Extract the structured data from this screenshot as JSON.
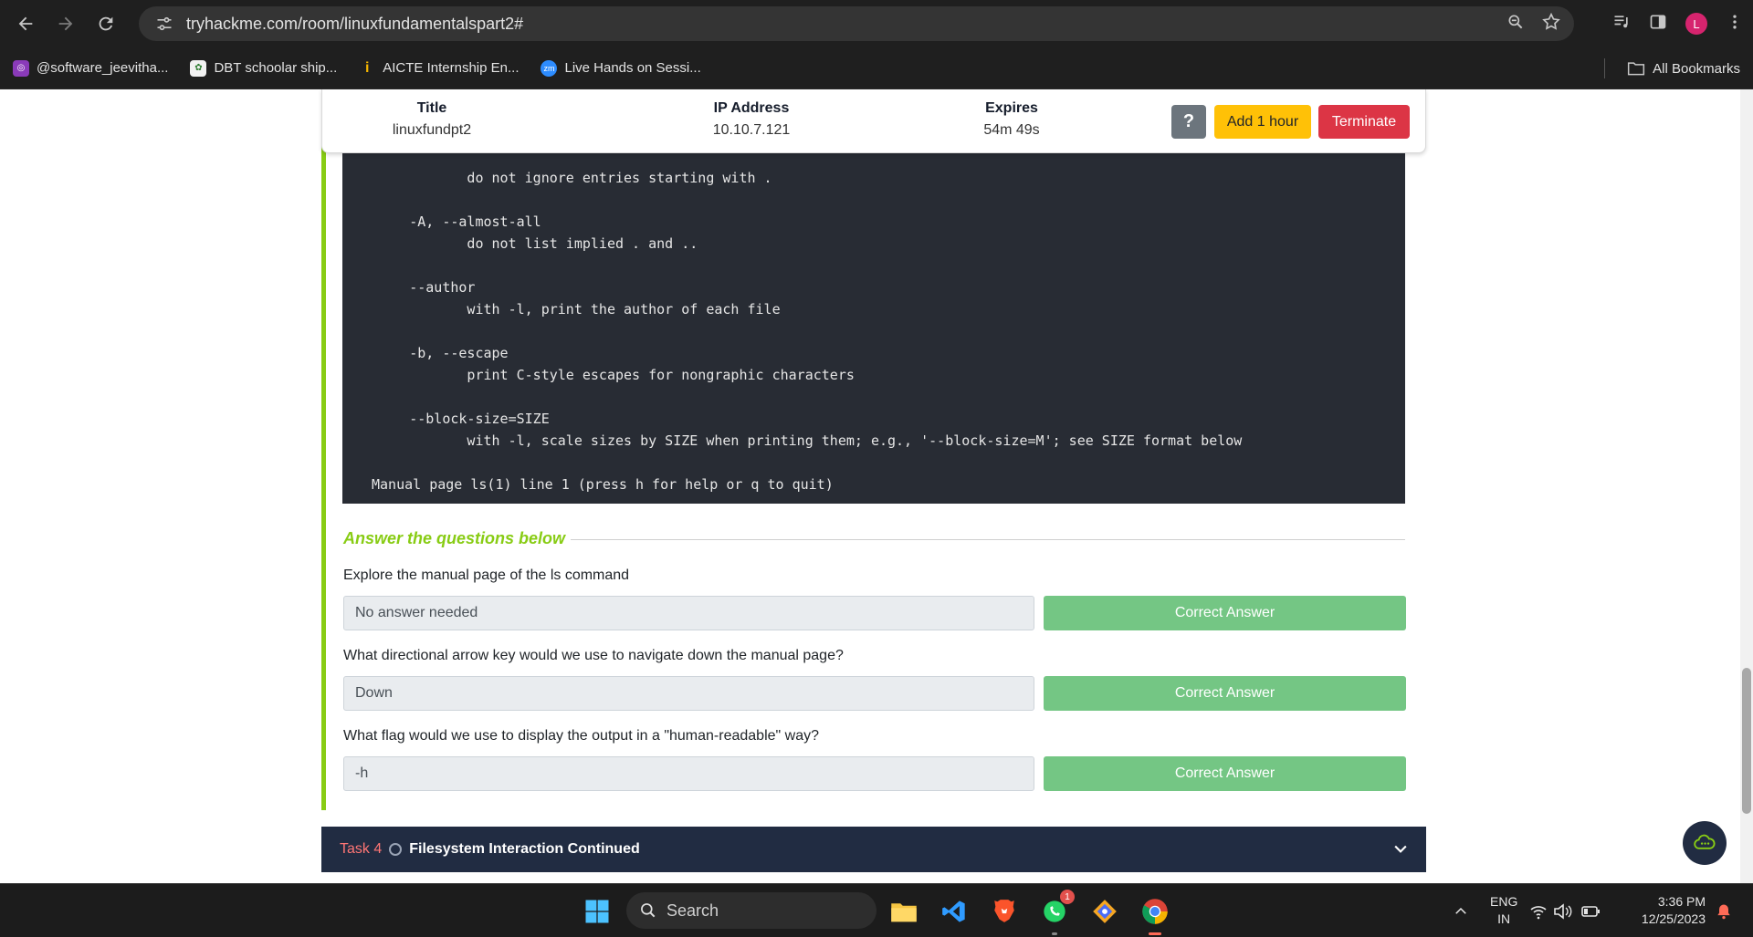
{
  "browser": {
    "url": "tryhackme.com/room/linuxfundamentalspart2#",
    "profile_initial": "L",
    "bookmarks": [
      {
        "label": "@software_jeevitha...",
        "icon": "instagram-icon",
        "color": "#8a3ab9"
      },
      {
        "label": "DBT schoolar ship...",
        "icon": "emblem-icon",
        "color": "#f2f2f2"
      },
      {
        "label": "AICTE Internship En...",
        "icon": "aicte-icon",
        "color": "#f4b400"
      },
      {
        "label": "Live Hands on Sessi...",
        "icon": "zoom-icon",
        "color": "#2d8cff"
      }
    ],
    "all_bookmarks_label": "All Bookmarks"
  },
  "vm": {
    "title_header": "Title",
    "title_value": "linuxfundpt2",
    "ip_header": "IP Address",
    "ip_value": "10.10.7.121",
    "expires_header": "Expires",
    "expires_value": "54m 49s",
    "help_label": "?",
    "add_hour_label": "Add 1 hour",
    "terminate_label": "Terminate"
  },
  "terminal": {
    "lines": [
      "              do not ignore entries starting with .",
      "       -A, --almost-all",
      "              do not list implied . and ..",
      "       --author",
      "              with -l, print the author of each file",
      "       -b, --escape",
      "              print C-style escapes for nongraphic characters",
      "       --block-size=SIZE",
      "              with -l, scale sizes by SIZE when printing them; e.g., '--block-size=M'; see SIZE format below",
      "Manual page ls(1) line 1 (press h for help or q to quit)"
    ]
  },
  "questions": {
    "heading": "Answer the questions below",
    "items": [
      {
        "question": "Explore the manual page of the ls command",
        "answer": "No answer needed",
        "button": "Correct Answer"
      },
      {
        "question": "What directional arrow key would we use to navigate down the manual page?",
        "answer": "Down",
        "button": "Correct Answer"
      },
      {
        "question": "What flag would we use to display the output in a \"human-readable\" way?",
        "answer": "-h",
        "button": "Correct Answer"
      }
    ]
  },
  "next_task": {
    "number": "Task 4",
    "title": "Filesystem Interaction Continued"
  },
  "taskbar": {
    "search_label": "Search",
    "whatsapp_badge": "1",
    "lang_line1": "ENG",
    "lang_line2": "IN",
    "time": "3:36 PM",
    "date": "12/25/2023"
  },
  "colors": {
    "accent_green": "#88cc14",
    "correct_green": "#74c684",
    "terminate_red": "#dc3545",
    "add_hour_yellow": "#ffc107",
    "terminal_bg": "#282c34",
    "task_bar_bg": "#212c42"
  }
}
